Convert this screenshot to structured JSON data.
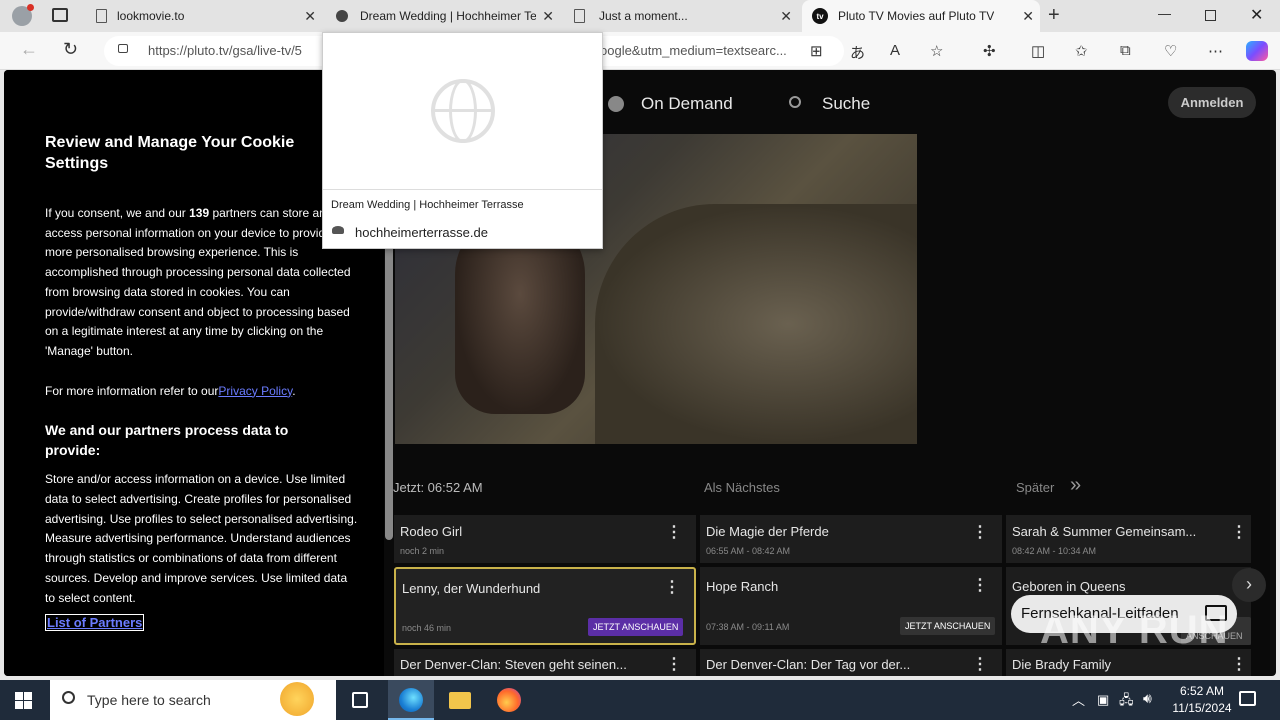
{
  "browser": {
    "tabs": [
      {
        "title": "lookmovie.to"
      },
      {
        "title": "Dream Wedding | Hochheimer Te"
      },
      {
        "title": "Just a moment..."
      },
      {
        "title": "Pluto TV Movies auf Pluto TV"
      }
    ],
    "url_left": "https://pluto.tv/gsa/live-tv/5",
    "url_right": "oogle&utm_medium=textsearc..."
  },
  "popup": {
    "title": "Dream Wedding | Hochheimer Terrasse",
    "domain": "hochheimerterrasse.de"
  },
  "site": {
    "logo": "pluto",
    "nav_on_demand": "On Demand",
    "nav_search": "Suche",
    "login": "Anmelden"
  },
  "cookie": {
    "heading": "Review and Manage Your Cookie Settings",
    "intro_a": "If you consent, we and our ",
    "partners_count": "139",
    "intro_b": " partners can store and/or access personal information on your device to provide a more personalised browsing experience. This is accomplished through processing personal data collected from browsing data stored in cookies. You can provide/withdraw consent and object to processing based on a legitimate interest at any time by clicking on the 'Manage' button.",
    "more_info": "For more information refer to our",
    "privacy_link": "Privacy Policy",
    "period": ".",
    "subheading": "We and our partners process data to provide:",
    "purposes": "Store and/or access information on a device. Use limited data to select advertising. Create profiles for personalised advertising. Use profiles to select personalised advertising. Measure advertising performance. Understand audiences through statistics or combinations of data from different sources. Develop and improve services. Use limited data to select content.",
    "partners_link": "List of Partners"
  },
  "guide": {
    "now": "Jetzt: 06:52 AM",
    "next": "Als Nächstes",
    "later": "Später",
    "rows": [
      [
        {
          "title": "Rodeo Girl",
          "sub": "noch 2 min"
        },
        {
          "title": "Die Magie der Pferde",
          "sub": "06:55 AM - 08:42 AM"
        },
        {
          "title": "Sarah & Summer Gemeinsam...",
          "sub": "08:42 AM - 10:34 AM"
        }
      ],
      [
        {
          "title": "Lenny, der Wunderhund",
          "sub": "noch 46 min",
          "button": "JETZT ANSCHAUEN"
        },
        {
          "title": "Hope Ranch",
          "sub": "07:38 AM - 09:11 AM",
          "button": "JETZT ANSCHAUEN"
        },
        {
          "title": "Geboren in Queens",
          "sub": "",
          "button": "JETZT ANSCHAUEN"
        }
      ],
      [
        {
          "title": "Der Denver-Clan: Steven geht seinen...",
          "sub": ""
        },
        {
          "title": "Der Denver-Clan: Der Tag vor der...",
          "sub": ""
        },
        {
          "title": "Die Brady Family",
          "sub": ""
        }
      ]
    ],
    "guide_button": "Fernsehkanal-Leitfaden",
    "channel_logo": "pluto"
  },
  "watermark": "ANY RUN",
  "taskbar": {
    "search_placeholder": "Type here to search",
    "time": "6:52 AM",
    "date": "11/15/2024"
  },
  "colors": {
    "accent_purple": "#5b2ea6",
    "gold_border": "#c9b24a",
    "page_bg": "#0a0a0a"
  }
}
